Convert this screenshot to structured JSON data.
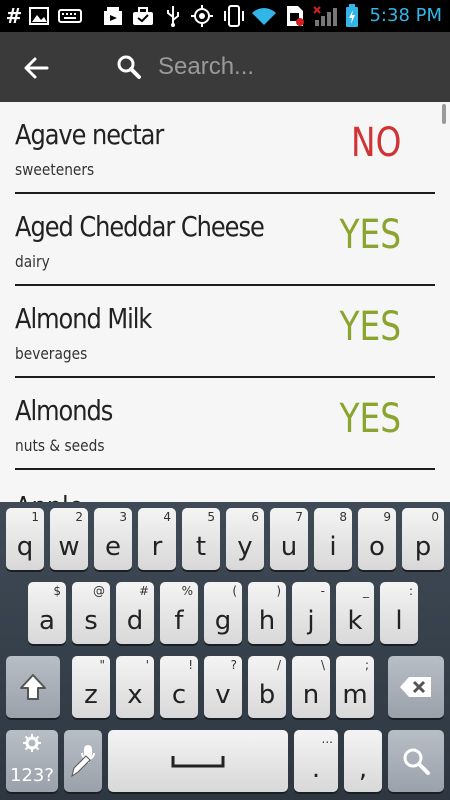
{
  "status_bar": {
    "time": "5:38 PM",
    "icons": [
      "hash-icon",
      "image-icon",
      "keyboard-icon",
      "download-icon",
      "briefcase-icon",
      "usb-icon",
      "gps-icon",
      "vibrate-icon",
      "wifi-icon",
      "sim-icon",
      "signal-icon",
      "battery-charging-icon"
    ],
    "hash_glyph": "#"
  },
  "app_bar": {
    "search_placeholder": "Search..."
  },
  "colors": {
    "no": "#d03333",
    "yes": "#8aa52d",
    "accent": "#31b6e7"
  },
  "items": [
    {
      "name": "Agave nectar",
      "category": "sweeteners",
      "verdict": "NO"
    },
    {
      "name": "Aged Cheddar Cheese",
      "category": "dairy",
      "verdict": "YES"
    },
    {
      "name": "Almond Milk",
      "category": "beverages",
      "verdict": "YES"
    },
    {
      "name": "Almonds",
      "category": "nuts & seeds",
      "verdict": "YES"
    }
  ],
  "peek_item": "Apple",
  "keyboard": {
    "row1": [
      {
        "key": "q",
        "hint": "1"
      },
      {
        "key": "w",
        "hint": "2"
      },
      {
        "key": "e",
        "hint": "3"
      },
      {
        "key": "r",
        "hint": "4"
      },
      {
        "key": "t",
        "hint": "5"
      },
      {
        "key": "y",
        "hint": "6"
      },
      {
        "key": "u",
        "hint": "7"
      },
      {
        "key": "i",
        "hint": "8"
      },
      {
        "key": "o",
        "hint": "9"
      },
      {
        "key": "p",
        "hint": "0"
      }
    ],
    "row2": [
      {
        "key": "a",
        "hint": "$"
      },
      {
        "key": "s",
        "hint": "@"
      },
      {
        "key": "d",
        "hint": "#"
      },
      {
        "key": "f",
        "hint": "%"
      },
      {
        "key": "g",
        "hint": "("
      },
      {
        "key": "h",
        "hint": ")"
      },
      {
        "key": "j",
        "hint": "-"
      },
      {
        "key": "k",
        "hint": "_"
      },
      {
        "key": "l",
        "hint": ":"
      }
    ],
    "row3": [
      {
        "key": "z",
        "hint": "\""
      },
      {
        "key": "x",
        "hint": "'"
      },
      {
        "key": "c",
        "hint": "!"
      },
      {
        "key": "v",
        "hint": "?"
      },
      {
        "key": "b",
        "hint": "/"
      },
      {
        "key": "n",
        "hint": "\\"
      },
      {
        "key": "m",
        "hint": ";"
      }
    ],
    "symbols_label": "123?",
    "period": ".",
    "period_hint": "...",
    "comma": ","
  }
}
